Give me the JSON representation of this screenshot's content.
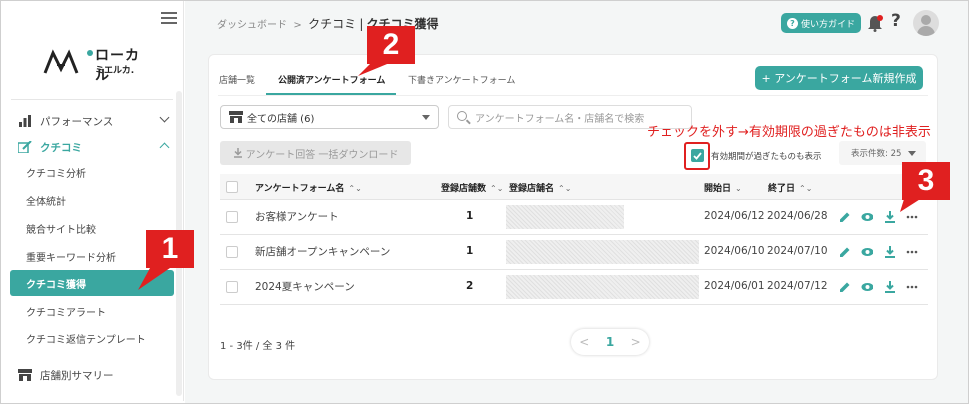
{
  "brand": {
    "logo_line1": "ローカル",
    "logo_line2": "ミエルカ.",
    "accent": "#3aa7a0",
    "annotation_red": "#e02020"
  },
  "sidebar": {
    "items": [
      {
        "label": "パフォーマンス",
        "icon": "bar-chart-icon"
      },
      {
        "label": "クチコミ",
        "icon": "pencil-box-icon"
      },
      {
        "label": "クチコミ分析"
      },
      {
        "label": "全体統計"
      },
      {
        "label": "競合サイト比較"
      },
      {
        "label": "重要キーワード分析"
      },
      {
        "label": "クチコミ獲得"
      },
      {
        "label": "クチコミアラート"
      },
      {
        "label": "クチコミ返信テンプレート"
      },
      {
        "label": "店舗別サマリー",
        "icon": "store-icon"
      }
    ]
  },
  "topbar": {
    "breadcrumb": [
      "ダッシュボード",
      "クチコミ",
      "クチコミ獲得"
    ],
    "sep": ">",
    "sep2": "|",
    "guide_label": "使い方ガイド",
    "help": "?"
  },
  "tabs": [
    "店舗一覧",
    "公開済アンケートフォーム",
    "下書きアンケートフォーム"
  ],
  "new_button": "+ アンケートフォーム新規作成",
  "filters": {
    "store_select": "全ての店舗 (6)",
    "search_placeholder": "アンケートフォーム名・店舗名で検索",
    "download_button": "アンケート回答 一括ダウンロード",
    "expired_label": "有効期間が過ぎたものも表示",
    "per_page": "表示件数: 25"
  },
  "annotation": {
    "text": "チェックを外す→有効期限の過ぎたものは非表示",
    "callouts": [
      "1",
      "2",
      "3"
    ]
  },
  "table": {
    "headers": [
      "アンケートフォーム名",
      "登録店舗数",
      "登録店舗名",
      "開始日",
      "終了日"
    ],
    "rows": [
      {
        "name": "お客様アンケート",
        "count": "1",
        "start": "2024/06/12",
        "end": "2024/06/28"
      },
      {
        "name": "新店舗オープンキャンペーン",
        "count": "1",
        "start": "2024/06/10",
        "end": "2024/07/10"
      },
      {
        "name": "2024夏キャンペーン",
        "count": "2",
        "start": "2024/06/01",
        "end": "2024/07/12"
      }
    ]
  },
  "pagination": {
    "summary": "1 - 3件 / 全 3 件",
    "prev": "<",
    "current": "1",
    "next": ">"
  }
}
